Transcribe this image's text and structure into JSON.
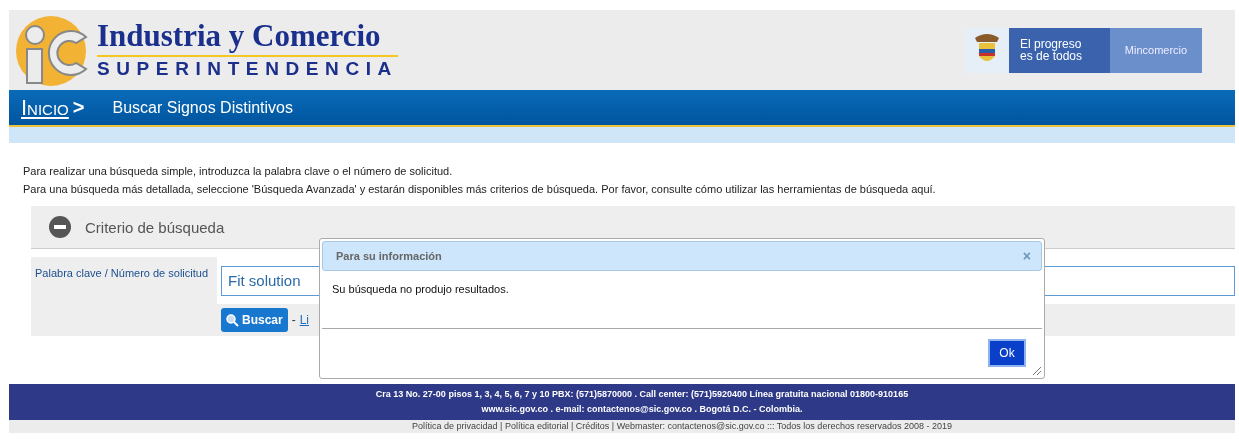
{
  "header": {
    "title": "Industria y Comercio",
    "subtitle": "SUPERINTENDENCIA",
    "slogan_line_1": "El progreso",
    "slogan_line_2": "es de todos",
    "ministry": "Mincomercio"
  },
  "breadcrumb": {
    "home": "Inicio",
    "separator": ">",
    "current": "Buscar Signos Distintivos"
  },
  "intro": [
    "Para realizar una búsqueda simple, introduzca la palabra clave o el número de solicitud.",
    "Para una búsqueda más detallada, seleccione 'Búsqueda Avanzada' y estarán disponibles más criterios de búsqueda. Por favor, consulte cómo utilizar las herramientas de búsqueda aquí."
  ],
  "criteria": {
    "title": "Criterio de búsqueda",
    "expanded": true,
    "field_label": "Palabra clave / Número de solicitud",
    "field_value": "Fit solution",
    "search_button": "Buscar",
    "separator": "-",
    "link": "Li"
  },
  "dialog": {
    "title": "Para su información",
    "close": "×",
    "message": "Su búsqueda no produjo resultados.",
    "ok": "Ok"
  },
  "footer": {
    "address": "Cra 13 No. 27-00 pisos 1, 3, 4, 5, 6, 7 y 10 PBX: (571)5870000 . Call center: (571)5920400 Línea gratuita nacional 01800-910165",
    "contact": "www.sic.gov.co . e-mail: contactenos@sic.gov.co . Bogotá D.C. - Colombia.",
    "legal": "Política de privacidad | Política editorial | Créditos | Webmaster: contactenos@sic.gov.co ::: Todos los derechos reservados 2008 - 2019"
  }
}
